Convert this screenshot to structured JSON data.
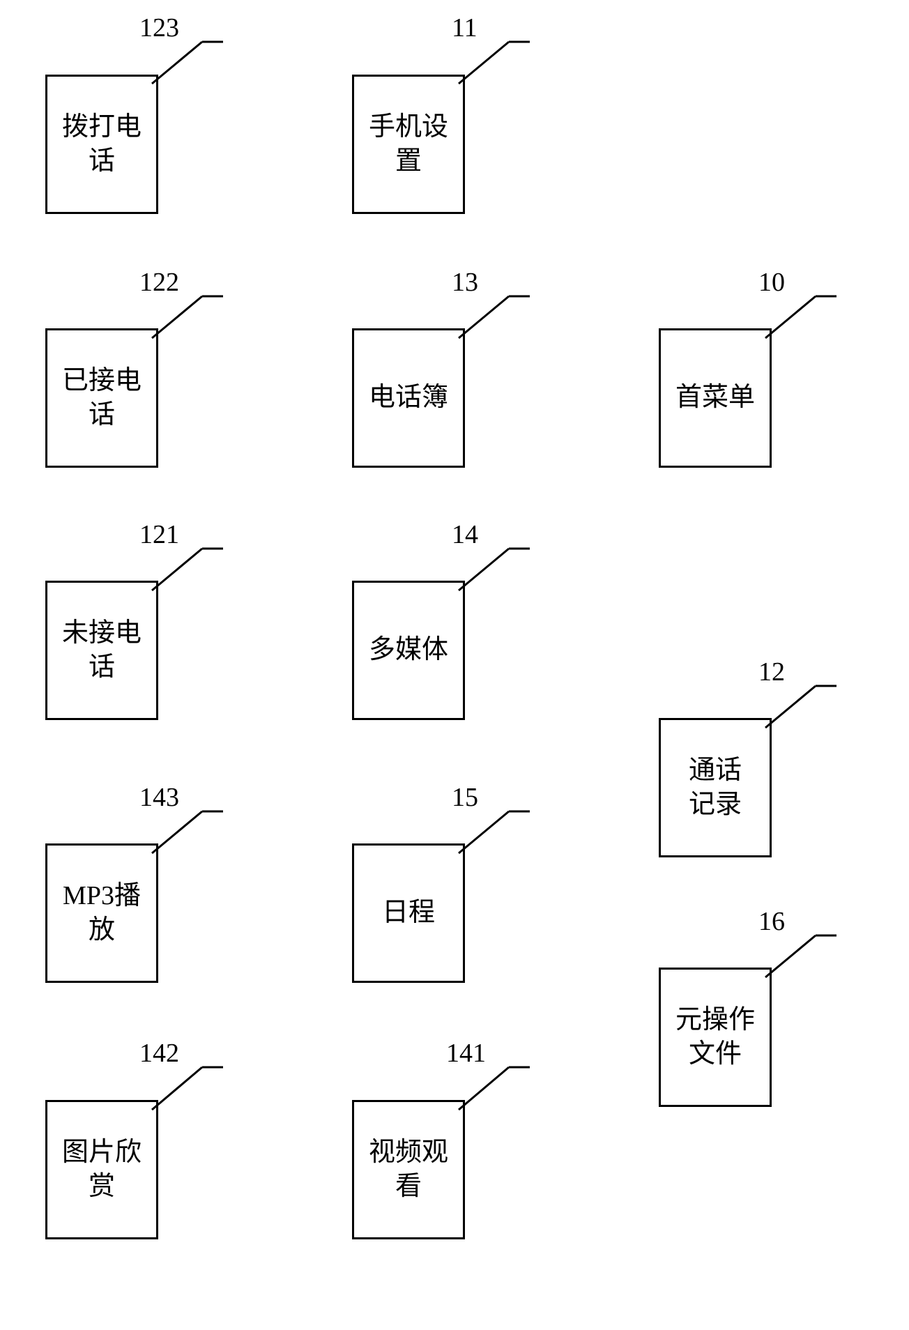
{
  "boxes": {
    "b123": {
      "label": "拨打电\n话",
      "ref": "123"
    },
    "b122": {
      "label": "已接电\n话",
      "ref": "122"
    },
    "b121": {
      "label": "未接电\n话",
      "ref": "121"
    },
    "b143": {
      "label": "MP3播\n放",
      "ref": "143"
    },
    "b142": {
      "label": "图片欣\n赏",
      "ref": "142"
    },
    "b11": {
      "label": "手机设\n置",
      "ref": "11"
    },
    "b13": {
      "label": "电话簿",
      "ref": "13"
    },
    "b14": {
      "label": "多媒体",
      "ref": "14"
    },
    "b15": {
      "label": "日程",
      "ref": "15"
    },
    "b141": {
      "label": "视频观\n看",
      "ref": "141"
    },
    "b10": {
      "label": "首菜单",
      "ref": "10"
    },
    "b12": {
      "label": "通话\n记录",
      "ref": "12"
    },
    "b16": {
      "label": "元操作\n文件",
      "ref": "16"
    }
  }
}
